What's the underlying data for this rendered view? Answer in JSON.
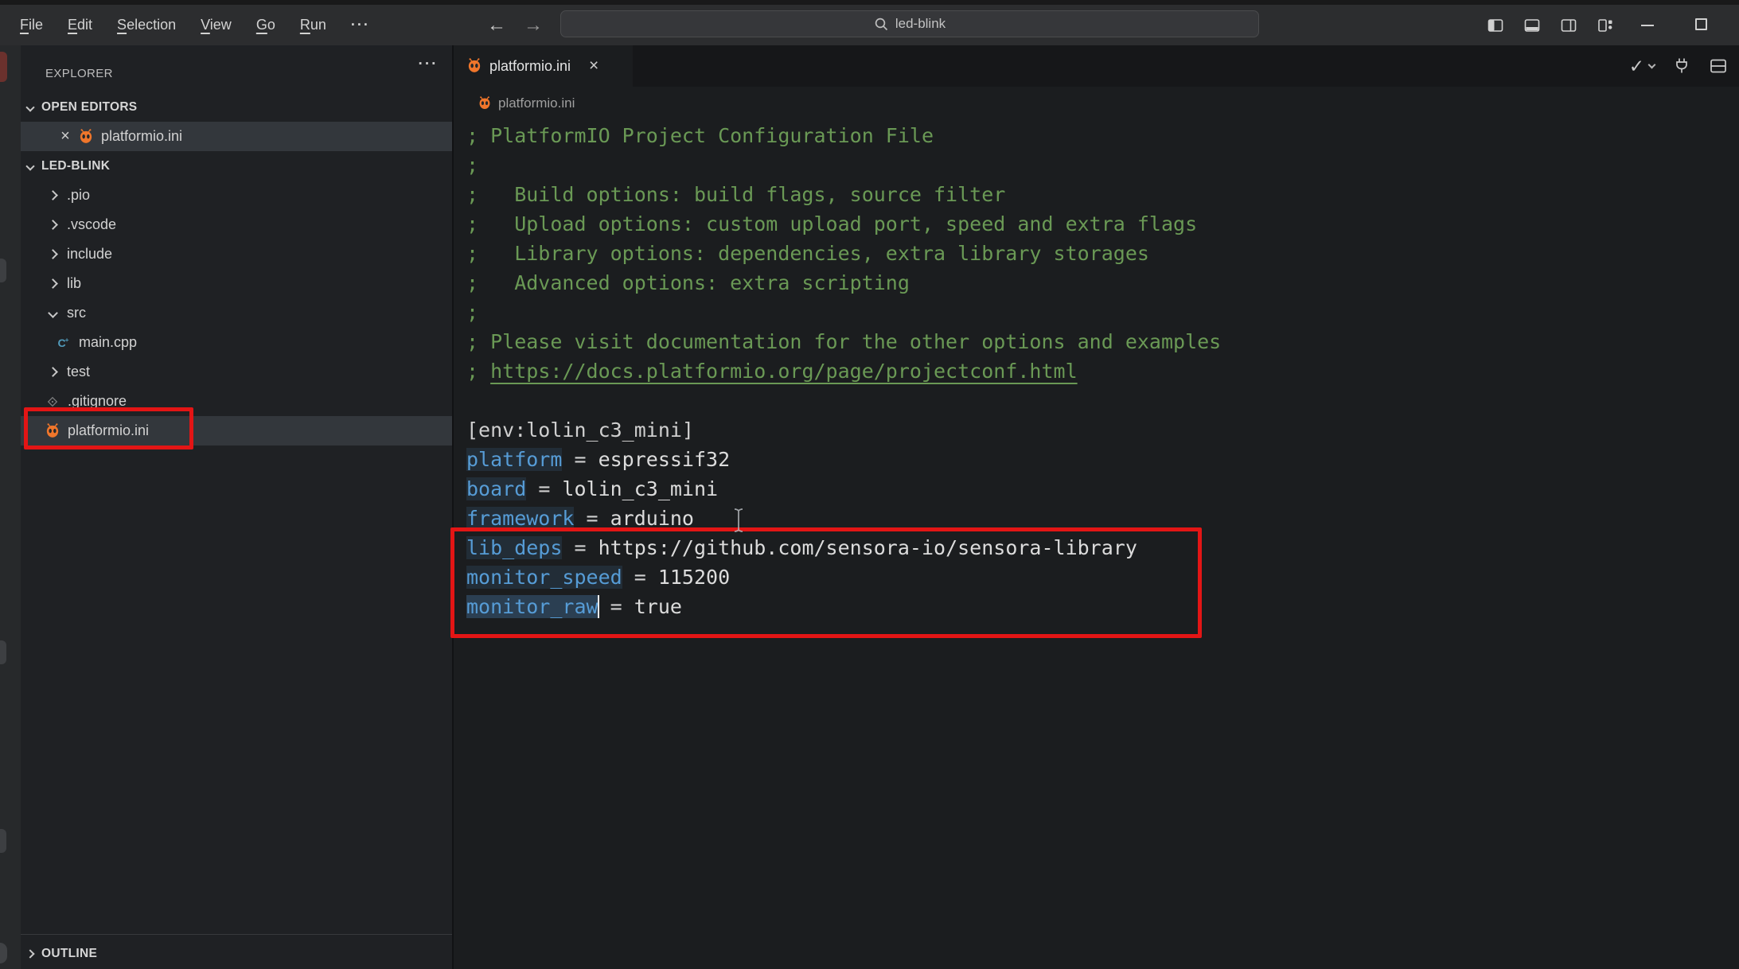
{
  "titlebar": {
    "menus": [
      {
        "label": "File"
      },
      {
        "label": "Edit"
      },
      {
        "label": "Selection"
      },
      {
        "label": "View"
      },
      {
        "label": "Go"
      },
      {
        "label": "Run"
      },
      {
        "label": "···",
        "plain": true
      }
    ],
    "back_glyph": "←",
    "forward_glyph": "→",
    "search": {
      "value": "led-blink",
      "icon": "search-icon"
    },
    "window_icons": [
      "toggle-primary-sidebar",
      "toggle-panel",
      "toggle-secondary-sidebar",
      "customize-layout",
      "minimize",
      "maximize"
    ]
  },
  "sidebar": {
    "title": "EXPLORER",
    "more_glyph": "···",
    "open_editors": {
      "label": "OPEN EDITORS",
      "items": [
        {
          "name": "platformio.ini",
          "icon": "platformio",
          "close_glyph": "×"
        }
      ]
    },
    "project": {
      "label": "LED-BLINK",
      "items": [
        {
          "kind": "folder",
          "name": ".pio",
          "expanded": false,
          "depth": 1
        },
        {
          "kind": "folder",
          "name": ".vscode",
          "expanded": false,
          "depth": 1
        },
        {
          "kind": "folder",
          "name": "include",
          "expanded": false,
          "depth": 1
        },
        {
          "kind": "folder",
          "name": "lib",
          "expanded": false,
          "depth": 1
        },
        {
          "kind": "folder",
          "name": "src",
          "expanded": true,
          "depth": 1
        },
        {
          "kind": "file",
          "name": "main.cpp",
          "icon": "cpp",
          "depth": 2
        },
        {
          "kind": "folder",
          "name": "test",
          "expanded": false,
          "depth": 1
        },
        {
          "kind": "file",
          "name": ".gitignore",
          "icon": "git",
          "depth": 1
        },
        {
          "kind": "file",
          "name": "platformio.ini",
          "icon": "platformio",
          "depth": 1,
          "selected": true
        }
      ]
    },
    "outline": {
      "label": "OUTLINE"
    }
  },
  "editor": {
    "tab": {
      "name": "platformio.ini",
      "icon": "platformio",
      "close_glyph": "×"
    },
    "actions": [
      "run-check",
      "chevron-down",
      "plug",
      "split-editor"
    ],
    "check_glyph": "✓",
    "breadcrumb": {
      "icon": "platformio",
      "name": "platformio.ini"
    },
    "code_lines": [
      {
        "tokens": [
          [
            "c",
            "; PlatformIO Project Configuration File"
          ]
        ]
      },
      {
        "tokens": [
          [
            "c",
            ";"
          ]
        ]
      },
      {
        "tokens": [
          [
            "c",
            ";   Build options: build flags, source filter"
          ]
        ]
      },
      {
        "tokens": [
          [
            "c",
            ";   Upload options: custom upload port, speed and extra flags"
          ]
        ]
      },
      {
        "tokens": [
          [
            "c",
            ";   Library options: dependencies, extra library storages"
          ]
        ]
      },
      {
        "tokens": [
          [
            "c",
            ";   Advanced options: extra scripting"
          ]
        ]
      },
      {
        "tokens": [
          [
            "c",
            ";"
          ]
        ]
      },
      {
        "tokens": [
          [
            "c",
            "; Please visit documentation for the other options and examples"
          ]
        ]
      },
      {
        "tokens": [
          [
            "c",
            "; "
          ],
          [
            "cl",
            "https://docs.platformio.org/page/projectconf.html"
          ]
        ]
      },
      {
        "tokens": []
      },
      {
        "tokens": [
          [
            "p",
            "[env:lolin_c3_mini]"
          ]
        ]
      },
      {
        "tokens": [
          [
            "k",
            "platform"
          ],
          [
            "p",
            " = "
          ],
          [
            "v",
            "espressif32"
          ]
        ]
      },
      {
        "tokens": [
          [
            "k",
            "board"
          ],
          [
            "p",
            " = "
          ],
          [
            "v",
            "lolin_c3_mini"
          ]
        ]
      },
      {
        "tokens": [
          [
            "k",
            "framework"
          ],
          [
            "p",
            " = "
          ],
          [
            "v",
            "arduino"
          ]
        ]
      },
      {
        "tokens": [
          [
            "k",
            "lib_deps"
          ],
          [
            "p",
            " = "
          ],
          [
            "v",
            "https://github.com/sensora-io/sensora-library"
          ]
        ]
      },
      {
        "tokens": [
          [
            "k",
            "monitor_speed"
          ],
          [
            "p",
            " = "
          ],
          [
            "v",
            "115200"
          ]
        ]
      },
      {
        "tokens": [
          [
            "kc",
            "monitor_raw"
          ],
          [
            "cur",
            ""
          ],
          [
            "p",
            " = "
          ],
          [
            "v",
            "true"
          ]
        ]
      }
    ]
  },
  "annotations": {
    "sidebar_box": "highlight around platformio.ini file",
    "editor_box": "highlight around lib_deps / monitor_speed / monitor_raw lines"
  },
  "colors": {
    "accent_red": "#e31515",
    "platformio_orange": "#f0762b",
    "comment_green": "#6a9955",
    "key_blue": "#569cd6",
    "cpp_blue": "#519aba"
  }
}
